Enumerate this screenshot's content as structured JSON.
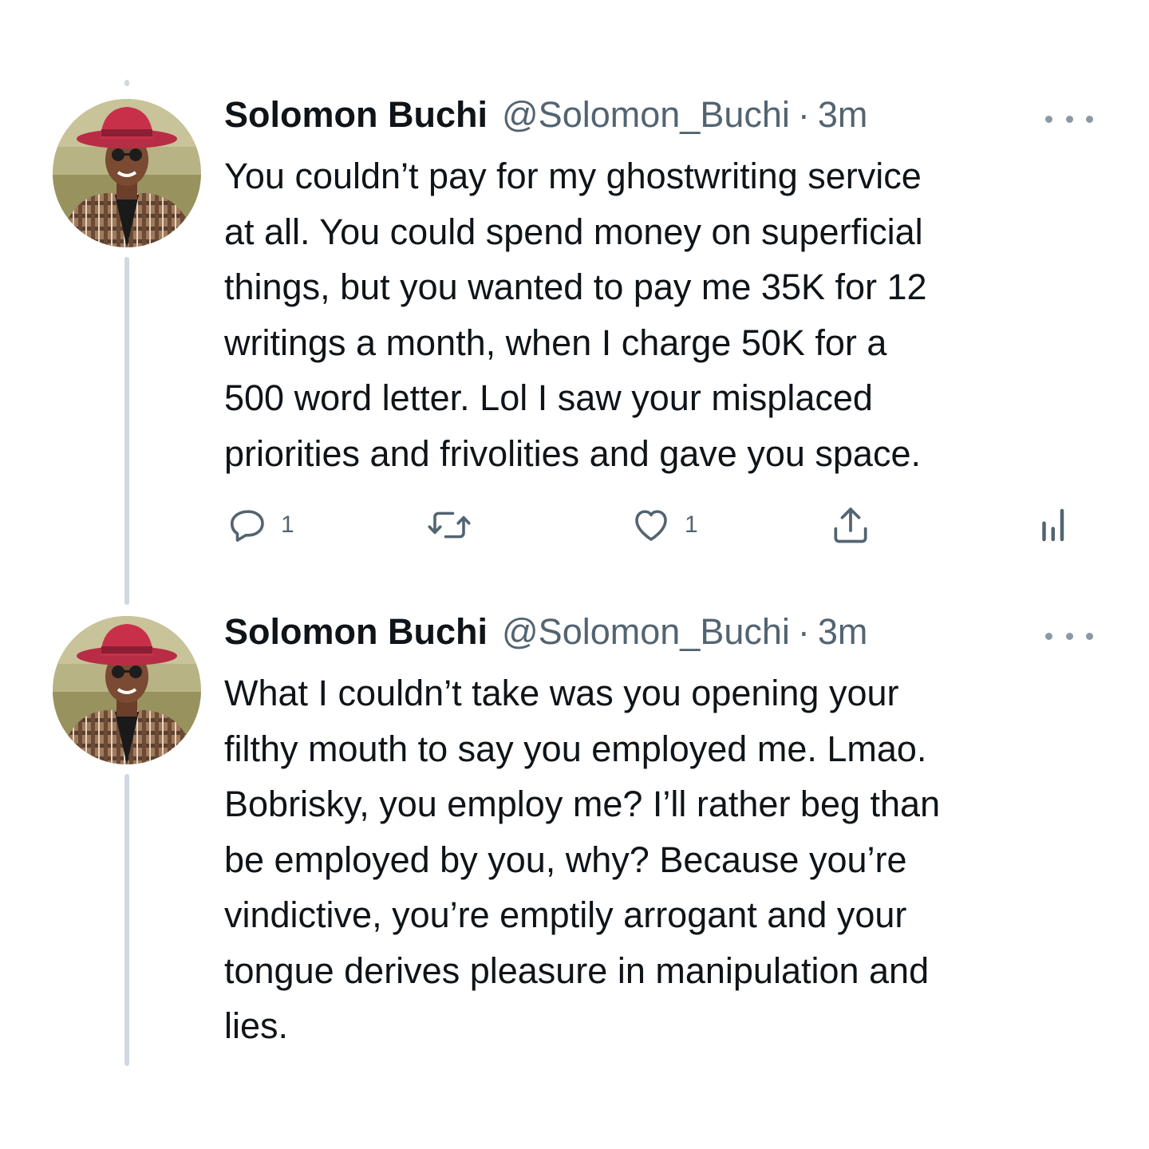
{
  "tweets": [
    {
      "author_name": "Solomon Buchi",
      "handle": "@Solomon_Buchi",
      "separator": "·",
      "time": "3m",
      "text": "You couldn’t pay for my ghostwriting service\nat all. You could spend money on superficial\nthings, but you wanted to pay me 35K for 12\nwritings a month, when I charge 50K for a\n500 word letter. Lol I saw your misplaced\npriorities and frivolities and gave you space.",
      "reply_count": "1",
      "like_count": "1",
      "icons": {
        "reply": "reply-icon",
        "retweet": "retweet-icon",
        "like": "heart-icon",
        "share": "share-icon",
        "analytics": "analytics-icon",
        "more": "more-icon"
      }
    },
    {
      "author_name": "Solomon Buchi",
      "handle": "@Solomon_Buchi",
      "separator": "·",
      "time": "3m",
      "text": "What I couldn’t take was you opening your\nfilthy mouth to say you employed me. Lmao.\nBobrisky, you employ me? I’ll rather beg than\nbe employed by you, why? Because you’re\nvindictive, you’re emptily arrogant and your\ntongue derives pleasure in manipulation and\nlies.",
      "icons": {
        "more": "more-icon"
      }
    }
  ],
  "colors": {
    "text_primary": "#0f1419",
    "text_secondary": "#536471",
    "thread_line": "#cfd9de",
    "hat": "#c8304a",
    "background": "#ffffff"
  }
}
